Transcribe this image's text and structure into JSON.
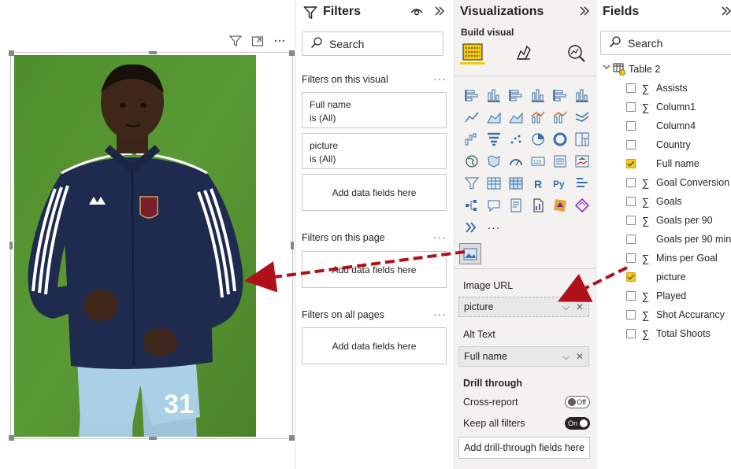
{
  "filters": {
    "title": "Filters",
    "search_placeholder": "Search",
    "on_this_visual_label": "Filters on this visual",
    "visual_filters": [
      {
        "field": "Full name",
        "condition": "is (All)"
      },
      {
        "field": "picture",
        "condition": "is (All)"
      }
    ],
    "add_data_fields": "Add data fields here",
    "on_this_page_label": "Filters on this page",
    "on_all_pages_label": "Filters on all pages"
  },
  "visualizations": {
    "title": "Visualizations",
    "build_visual_label": "Build visual",
    "image_url_label": "Image URL",
    "image_url_value": "picture",
    "alt_text_label": "Alt Text",
    "alt_text_value": "Full name",
    "drill_through_label": "Drill through",
    "cross_report_label": "Cross-report",
    "cross_report_toggle": "Off",
    "keep_all_filters_label": "Keep all filters",
    "keep_all_filters_toggle": "On",
    "add_drill_through": "Add drill-through fields here",
    "more_visuals": "···"
  },
  "fields": {
    "title": "Fields",
    "search_placeholder": "Search",
    "table_name": "Table 2",
    "items": [
      {
        "name": "Assists",
        "sigma": "∑",
        "checked": false
      },
      {
        "name": "Column1",
        "sigma": "∑",
        "checked": false
      },
      {
        "name": "Column4",
        "sigma": "",
        "checked": false
      },
      {
        "name": "Country",
        "sigma": "",
        "checked": false
      },
      {
        "name": "Full name",
        "sigma": "",
        "checked": true
      },
      {
        "name": "Goal Conversion",
        "sigma": "∑",
        "checked": false
      },
      {
        "name": "Goals",
        "sigma": "∑",
        "checked": false
      },
      {
        "name": "Goals per 90",
        "sigma": "∑",
        "checked": false
      },
      {
        "name": "Goals per 90 min...",
        "sigma": "",
        "checked": false
      },
      {
        "name": "Mins per Goal",
        "sigma": "∑",
        "checked": false
      },
      {
        "name": "picture",
        "sigma": "",
        "checked": true
      },
      {
        "name": "Played",
        "sigma": "∑",
        "checked": false
      },
      {
        "name": "Shot Accurancy",
        "sigma": "∑",
        "checked": false
      },
      {
        "name": "Total Shoots",
        "sigma": "∑",
        "checked": false
      }
    ]
  },
  "visual": {
    "jersey_number": "31"
  },
  "colors": {
    "accent_yellow": "#f2c811",
    "arrow_red": "#b0101a",
    "pitch_green": "#4e8a2f",
    "jacket_navy": "#1f2a4f"
  }
}
